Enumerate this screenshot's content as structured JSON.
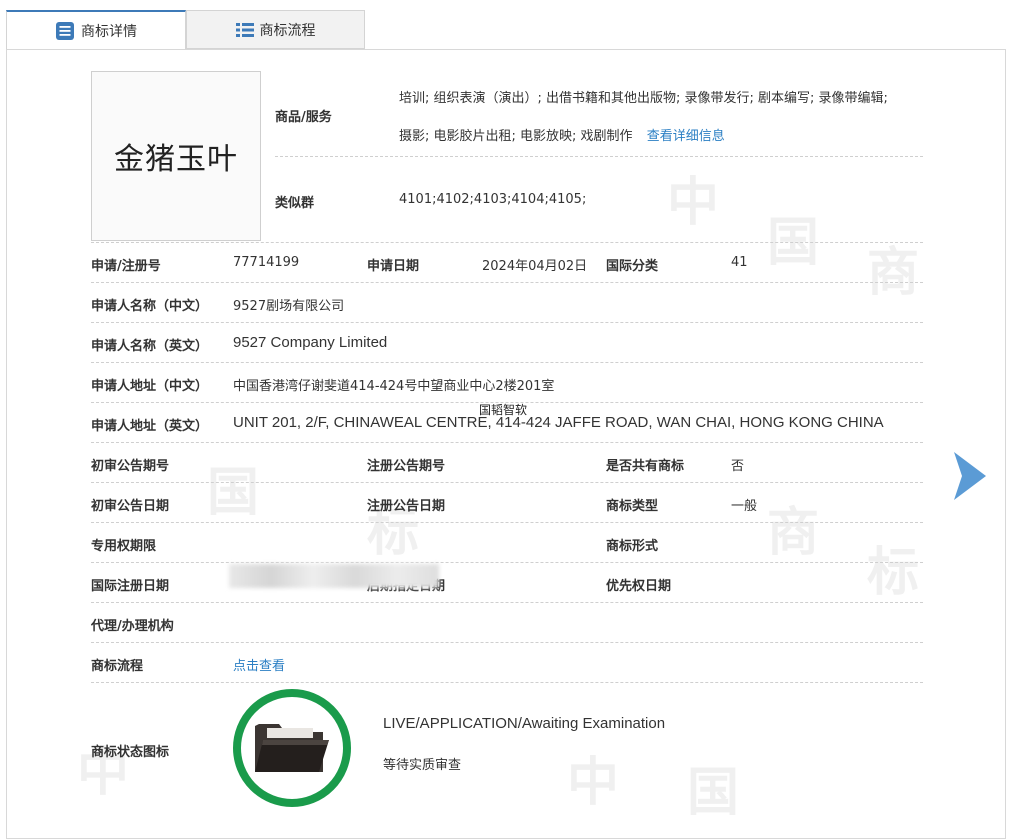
{
  "tabs": [
    {
      "label": "商标详情",
      "icon": "list-doc-icon",
      "active": true
    },
    {
      "label": "商标流程",
      "icon": "list-bullets-icon",
      "active": false
    }
  ],
  "logo": {
    "text": "金猪玉叶"
  },
  "goods": {
    "label": "商品/服务",
    "line1": "培训; 组织表演（演出）; 出借书籍和其他出版物; 录像带发行; 剧本编写; 录像带编辑;",
    "line2": "摄影; 电影胶片出租; 电影放映; 戏剧制作",
    "detail_link": "查看详细信息"
  },
  "similar": {
    "label": "类似群",
    "value": "4101;4102;4103;4104;4105;"
  },
  "rows": {
    "reg_no": {
      "label": "申请/注册号",
      "value": "77714199"
    },
    "app_date": {
      "label": "申请日期",
      "value": "2024年04月02日"
    },
    "intl_class": {
      "label": "国际分类",
      "value": "41"
    },
    "applicant_cn": {
      "label": "申请人名称（中文）",
      "value": "9527剧场有限公司"
    },
    "applicant_en": {
      "label": "申请人名称（英文）",
      "value": "9527 Company Limited"
    },
    "address_cn": {
      "label": "申请人地址（中文）",
      "value": "中国香港湾仔谢斐道414-424号中望商业中心2楼201室"
    },
    "address_en": {
      "label": "申请人地址（英文）",
      "value": "UNIT 201, 2/F, CHINAWEAL CENTRE, 414-424 JAFFE ROAD, WAN CHAI, HONG KONG CHINA"
    },
    "prelim_no": {
      "label": "初审公告期号",
      "value": ""
    },
    "reg_pub_no": {
      "label": "注册公告期号",
      "value": ""
    },
    "shared": {
      "label": "是否共有商标",
      "value": "否"
    },
    "prelim_date": {
      "label": "初审公告日期",
      "value": ""
    },
    "reg_pub_date": {
      "label": "注册公告日期",
      "value": ""
    },
    "tm_type": {
      "label": "商标类型",
      "value": "一般"
    },
    "exclusive": {
      "label": "专用权期限",
      "value": ""
    },
    "tm_form": {
      "label": "商标形式",
      "value": ""
    },
    "intl_reg_date": {
      "label": "国际注册日期",
      "value": ""
    },
    "later_date": {
      "label": "后期指定日期",
      "value": ""
    },
    "priority_date": {
      "label": "优先权日期",
      "value": ""
    },
    "agent": {
      "label": "代理/办理机构",
      "value": ""
    },
    "process": {
      "label": "商标流程",
      "link": "点击查看"
    }
  },
  "status": {
    "label": "商标状态图标",
    "icon": "folder-icon",
    "en": "LIVE/APPLICATION/Awaiting Examination",
    "cn": "等待实质审查"
  },
  "overlay_text": "国韬智软",
  "colors": {
    "accent": "#2b7fc4",
    "status_ring": "#1a9b4b",
    "arrow": "#5b9bd5"
  }
}
